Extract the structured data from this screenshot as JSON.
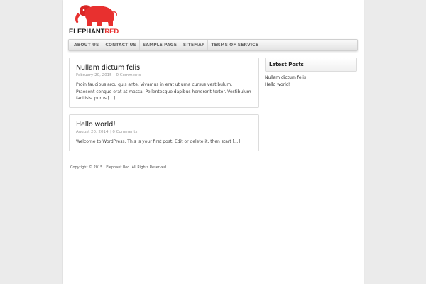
{
  "site": {
    "logo_text_1": "ELEPHANT",
    "logo_text_2": "RED",
    "brand_color": "#e8302f"
  },
  "nav": {
    "items": [
      "ABOUT US",
      "CONTACT US",
      "SAMPLE PAGE",
      "SITEMAP",
      "TERMS OF SERVICE"
    ]
  },
  "posts": [
    {
      "title": "Nullam dictum felis",
      "date": "February 20, 2015",
      "separator": "|",
      "comments": "0 Comments",
      "excerpt": "Proin faucibus arcu quis ante. Vivamus in erat ut urna cursus vestibulum. Praesent congue erat at massa. Pellentesque dapibus hendrerit tortor. Vestibulum facilisis, purus [...]"
    },
    {
      "title": "Hello world!",
      "date": "August 20, 2014",
      "separator": "|",
      "comments": "0 Comments",
      "excerpt": "Welcome to WordPress. This is your first post. Edit or delete it, then start [...]"
    }
  ],
  "sidebar": {
    "widget_title": "Latest Posts",
    "links": [
      "Nullam dictum felis",
      "Hello world!"
    ]
  },
  "footer": {
    "copyright": "Copyright © 2015 | Elephant Red. All Rights Reserved."
  }
}
